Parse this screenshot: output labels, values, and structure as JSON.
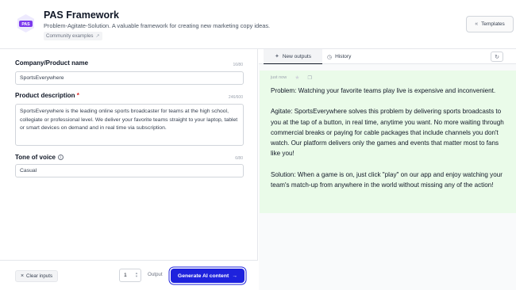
{
  "header": {
    "title": "PAS Framework",
    "logo_text": "PAS",
    "subtitle": "Problem-Agitate-Solution. A valuable framework for creating new marketing copy ideas.",
    "community_label": "Community examples",
    "templates_label": "Templates",
    "logo_color": "#7c3aed"
  },
  "form": {
    "company": {
      "label": "Company/Product name",
      "counter": "16/80",
      "value": "SportsEverywhere"
    },
    "description": {
      "label": "Product description",
      "required_mark": "*",
      "counter": "246/600",
      "value": "SportsEverywhere is the leading online sports broadcaster for teams at the high school, collegiate or professional level. We deliver your favorite teams straight to your laptop, tablet or smart devices on demand and in real time via subscription."
    },
    "tone": {
      "label": "Tone of voice",
      "counter": "6/80",
      "value": "Casual"
    }
  },
  "footer": {
    "clear_label": "Clear inputs",
    "output_count": "1",
    "output_label": "Output",
    "generate_label": "Generate AI content",
    "generate_color": "#1e22dd"
  },
  "tabs": {
    "new_outputs": "New outputs",
    "history": "History"
  },
  "output": {
    "timestamp": "just now",
    "card_color": "#eafbe9",
    "paragraphs": [
      "Problem: Watching your favorite teams play live is expensive and inconvenient.",
      "Agitate: SportsEverywhere solves this problem by delivering sports broadcasts to you at the tap of a button, in real time, anytime you want. No more waiting through commercial breaks or paying for cable packages that include channels you don't watch. Our platform delivers only the games and events that matter most to fans like you!",
      "Solution: When a game is on, just click \"play\" on our app and enjoy watching your team's match-up from anywhere in the world without missing any of the action!"
    ]
  }
}
